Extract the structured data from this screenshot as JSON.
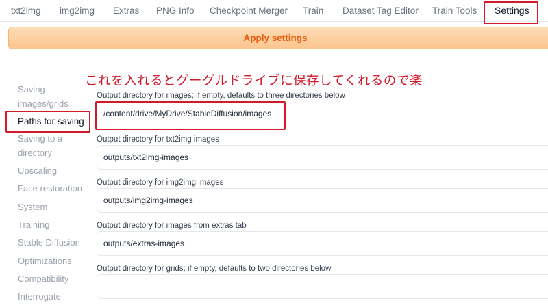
{
  "tabs": [
    {
      "label": "txt2img"
    },
    {
      "label": "img2img"
    },
    {
      "label": "Extras"
    },
    {
      "label": "PNG Info"
    },
    {
      "label": "Checkpoint Merger"
    },
    {
      "label": "Train"
    },
    {
      "label": "Dataset Tag Editor"
    },
    {
      "label": "Train Tools"
    },
    {
      "label": "Settings",
      "active": true
    }
  ],
  "apply_label": "Apply settings",
  "annotation": "これを入れるとグーグルドライブに保存してくれるので楽",
  "sidebar": {
    "items": [
      {
        "label": "Saving images/grids"
      },
      {
        "label": "Paths for saving",
        "active": true
      },
      {
        "label": "Saving to a directory"
      },
      {
        "label": "Upscaling"
      },
      {
        "label": "Face restoration"
      },
      {
        "label": "System"
      },
      {
        "label": "Training"
      },
      {
        "label": "Stable Diffusion"
      },
      {
        "label": "Optimizations"
      },
      {
        "label": "Compatibility"
      },
      {
        "label": "Interrogate"
      }
    ]
  },
  "fields": [
    {
      "label": "Output directory for images; if empty, defaults to three directories below",
      "value": "/content/drive/MyDrive/StableDiffusion/images"
    },
    {
      "label": "Output directory for txt2img images",
      "value": "outputs/txt2img-images"
    },
    {
      "label": "Output directory for img2img images",
      "value": "outputs/img2img-images"
    },
    {
      "label": "Output directory for images from extras tab",
      "value": "outputs/extras-images"
    },
    {
      "label": "Output directory for grids; if empty, defaults to two directories below",
      "value": ""
    }
  ],
  "colors": {
    "accent": "#ea580c",
    "highlight": "#d11a2a"
  }
}
